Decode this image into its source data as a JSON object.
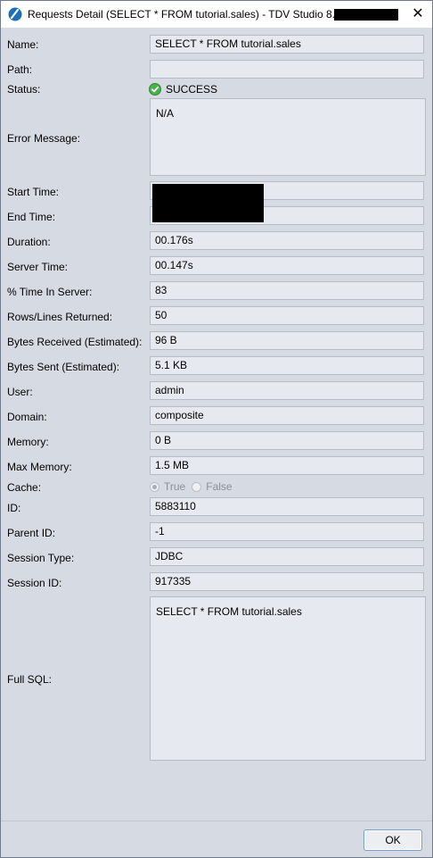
{
  "window": {
    "title": "Requests Detail (SELECT * FROM tutorial.sales) - TDV Studio 8.5 @",
    "close_symbol": "✕"
  },
  "labels": {
    "name": "Name:",
    "path": "Path:",
    "status": "Status:",
    "error": "Error Message:",
    "start": "Start Time:",
    "end": "End Time:",
    "duration": "Duration:",
    "server_time": "Server Time:",
    "pct_server": "% Time In Server:",
    "rows": "Rows/Lines Returned:",
    "bytes_recv": "Bytes Received (Estimated):",
    "bytes_sent": "Bytes Sent (Estimated):",
    "user": "User:",
    "domain": "Domain:",
    "memory": "Memory:",
    "max_memory": "Max Memory:",
    "cache": "Cache:",
    "id": "ID:",
    "parent_id": "Parent ID:",
    "session_type": "Session Type:",
    "session_id": "Session ID:",
    "full_sql": "Full SQL:"
  },
  "values": {
    "name": "SELECT * FROM tutorial.sales",
    "path": "",
    "status": "SUCCESS",
    "error": "N/A",
    "duration": "00.176s",
    "server_time": "00.147s",
    "pct_server": "83",
    "rows": "50",
    "bytes_recv": "96 B",
    "bytes_sent": "5.1 KB",
    "user": "admin",
    "domain": "composite",
    "memory": "0 B",
    "max_memory": "1.5 MB",
    "cache_true": "True",
    "cache_false": "False",
    "id": "5883110",
    "parent_id": "-1",
    "session_type": "JDBC",
    "session_id": "917335",
    "full_sql": "SELECT * FROM tutorial.sales"
  },
  "buttons": {
    "ok": "OK"
  },
  "colors": {
    "success": "#4caf50",
    "accent": "#1c6fb8"
  },
  "icons": {
    "app": "tdv-studio-icon",
    "status": "check-circle-icon"
  }
}
